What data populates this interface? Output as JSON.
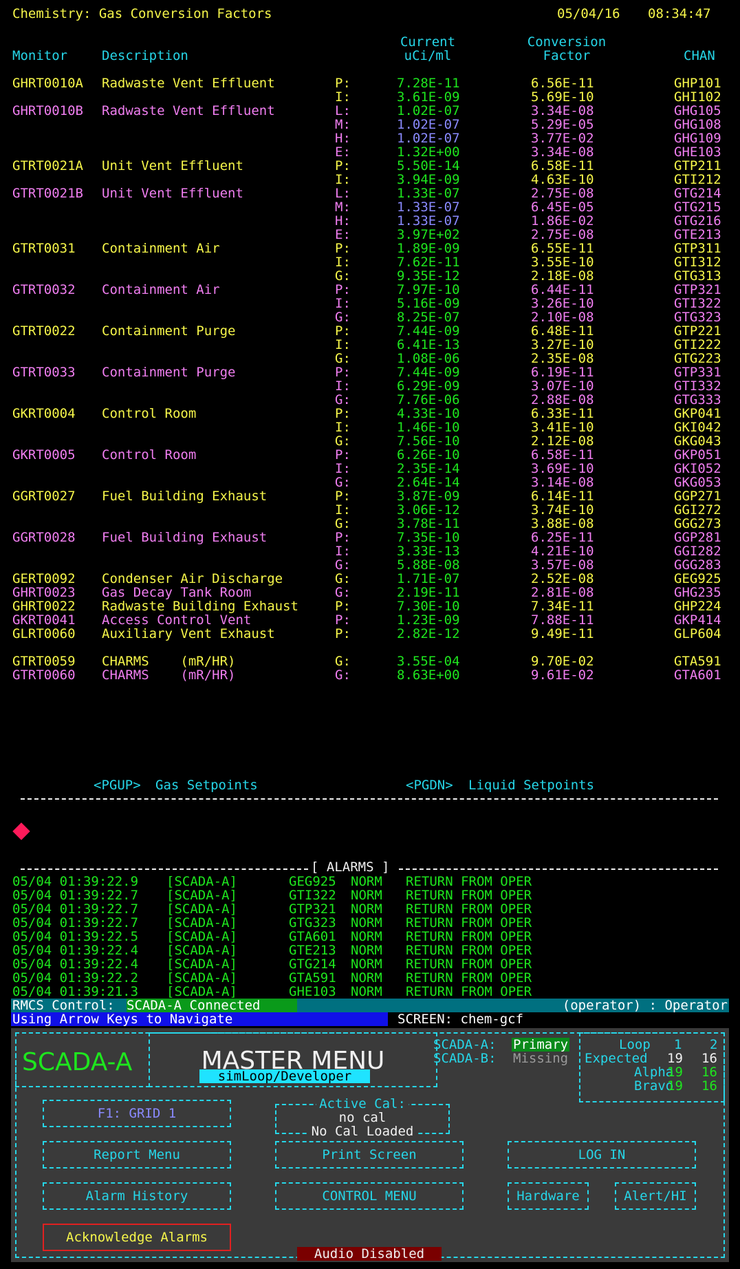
{
  "header": {
    "title": "Chemistry: Gas Conversion Factors",
    "date": "05/04/16",
    "time": "08:34:47"
  },
  "columns": {
    "monitor": "Monitor",
    "description": "Description",
    "current1": "Current",
    "current2": "uCi/ml",
    "conversion1": "Conversion",
    "conversion2": "Factor",
    "chan": "CHAN"
  },
  "rows": [
    {
      "mon": "GHRT0010A",
      "desc": "Radwaste Vent Effluent",
      "type": "P:",
      "cur": "7.28E-11",
      "conv": "6.56E-11",
      "chan": "GHP101",
      "mc": "yellow",
      "curc": "green"
    },
    {
      "mon": "",
      "desc": "",
      "type": "I:",
      "cur": "3.61E-09",
      "conv": "5.69E-10",
      "chan": "GHI102",
      "mc": "yellow",
      "curc": "green"
    },
    {
      "mon": "GHRT0010B",
      "desc": "Radwaste Vent Effluent",
      "type": "L:",
      "cur": "1.02E-07",
      "conv": "3.34E-08",
      "chan": "GHG105",
      "mc": "pink",
      "curc": "green"
    },
    {
      "mon": "",
      "desc": "",
      "type": "M:",
      "cur": "1.02E-07",
      "conv": "5.29E-05",
      "chan": "GHG108",
      "mc": "pink",
      "curc": "blue"
    },
    {
      "mon": "",
      "desc": "",
      "type": "H:",
      "cur": "1.02E-07",
      "conv": "3.77E-02",
      "chan": "GHG109",
      "mc": "pink",
      "curc": "blue"
    },
    {
      "mon": "",
      "desc": "",
      "type": "E:",
      "cur": "1.32E+00",
      "conv": "3.34E-08",
      "chan": "GHE103",
      "mc": "pink",
      "curc": "green"
    },
    {
      "mon": "GTRT0021A",
      "desc": "Unit Vent Effluent",
      "type": "P:",
      "cur": "5.50E-14",
      "conv": "6.58E-11",
      "chan": "GTP211",
      "mc": "yellow",
      "curc": "green"
    },
    {
      "mon": "",
      "desc": "",
      "type": "I:",
      "cur": "3.94E-09",
      "conv": "4.63E-10",
      "chan": "GTI212",
      "mc": "yellow",
      "curc": "green"
    },
    {
      "mon": "GTRT0021B",
      "desc": "Unit Vent Effluent",
      "type": "L:",
      "cur": "1.33E-07",
      "conv": "2.75E-08",
      "chan": "GTG214",
      "mc": "pink",
      "curc": "green"
    },
    {
      "mon": "",
      "desc": "",
      "type": "M:",
      "cur": "1.33E-07",
      "conv": "6.45E-05",
      "chan": "GTG215",
      "mc": "pink",
      "curc": "blue"
    },
    {
      "mon": "",
      "desc": "",
      "type": "H:",
      "cur": "1.33E-07",
      "conv": "1.86E-02",
      "chan": "GTG216",
      "mc": "pink",
      "curc": "blue"
    },
    {
      "mon": "",
      "desc": "",
      "type": "E:",
      "cur": "3.97E+02",
      "conv": "2.75E-08",
      "chan": "GTE213",
      "mc": "pink",
      "curc": "green"
    },
    {
      "mon": "GTRT0031",
      "desc": "Containment Air",
      "type": "P:",
      "cur": "1.89E-09",
      "conv": "6.55E-11",
      "chan": "GTP311",
      "mc": "yellow",
      "curc": "green"
    },
    {
      "mon": "",
      "desc": "",
      "type": "I:",
      "cur": "7.62E-11",
      "conv": "3.55E-10",
      "chan": "GTI312",
      "mc": "yellow",
      "curc": "green"
    },
    {
      "mon": "",
      "desc": "",
      "type": "G:",
      "cur": "9.35E-12",
      "conv": "2.18E-08",
      "chan": "GTG313",
      "mc": "yellow",
      "curc": "green"
    },
    {
      "mon": "GTRT0032",
      "desc": "Containment Air",
      "type": "P:",
      "cur": "7.97E-10",
      "conv": "6.44E-11",
      "chan": "GTP321",
      "mc": "pink",
      "curc": "green"
    },
    {
      "mon": "",
      "desc": "",
      "type": "I:",
      "cur": "5.16E-09",
      "conv": "3.26E-10",
      "chan": "GTI322",
      "mc": "pink",
      "curc": "green"
    },
    {
      "mon": "",
      "desc": "",
      "type": "G:",
      "cur": "8.25E-07",
      "conv": "2.10E-08",
      "chan": "GTG323",
      "mc": "pink",
      "curc": "green"
    },
    {
      "mon": "GTRT0022",
      "desc": "Containment Purge",
      "type": "P:",
      "cur": "7.44E-09",
      "conv": "6.48E-11",
      "chan": "GTP221",
      "mc": "yellow",
      "curc": "green"
    },
    {
      "mon": "",
      "desc": "",
      "type": "I:",
      "cur": "6.41E-13",
      "conv": "3.27E-10",
      "chan": "GTI222",
      "mc": "yellow",
      "curc": "green"
    },
    {
      "mon": "",
      "desc": "",
      "type": "G:",
      "cur": "1.08E-06",
      "conv": "2.35E-08",
      "chan": "GTG223",
      "mc": "yellow",
      "curc": "green"
    },
    {
      "mon": "GTRT0033",
      "desc": "Containment Purge",
      "type": "P:",
      "cur": "7.44E-09",
      "conv": "6.19E-11",
      "chan": "GTP331",
      "mc": "pink",
      "curc": "green"
    },
    {
      "mon": "",
      "desc": "",
      "type": "I:",
      "cur": "6.29E-09",
      "conv": "3.07E-10",
      "chan": "GTI332",
      "mc": "pink",
      "curc": "green"
    },
    {
      "mon": "",
      "desc": "",
      "type": "G:",
      "cur": "7.76E-06",
      "conv": "2.88E-08",
      "chan": "GTG333",
      "mc": "pink",
      "curc": "green"
    },
    {
      "mon": "GKRT0004",
      "desc": "Control Room",
      "type": "P:",
      "cur": "4.33E-10",
      "conv": "6.33E-11",
      "chan": "GKP041",
      "mc": "yellow",
      "curc": "green"
    },
    {
      "mon": "",
      "desc": "",
      "type": "I:",
      "cur": "1.46E-10",
      "conv": "3.41E-10",
      "chan": "GKI042",
      "mc": "yellow",
      "curc": "green"
    },
    {
      "mon": "",
      "desc": "",
      "type": "G:",
      "cur": "7.56E-10",
      "conv": "2.12E-08",
      "chan": "GKG043",
      "mc": "yellow",
      "curc": "green"
    },
    {
      "mon": "GKRT0005",
      "desc": "Control Room",
      "type": "P:",
      "cur": "6.26E-10",
      "conv": "6.58E-11",
      "chan": "GKP051",
      "mc": "pink",
      "curc": "green"
    },
    {
      "mon": "",
      "desc": "",
      "type": "I:",
      "cur": "2.35E-14",
      "conv": "3.69E-10",
      "chan": "GKI052",
      "mc": "pink",
      "curc": "green"
    },
    {
      "mon": "",
      "desc": "",
      "type": "G:",
      "cur": "2.64E-14",
      "conv": "3.14E-08",
      "chan": "GKG053",
      "mc": "pink",
      "curc": "green"
    },
    {
      "mon": "GGRT0027",
      "desc": "Fuel Building Exhaust",
      "type": "P:",
      "cur": "3.87E-09",
      "conv": "6.14E-11",
      "chan": "GGP271",
      "mc": "yellow",
      "curc": "green"
    },
    {
      "mon": "",
      "desc": "",
      "type": "I:",
      "cur": "3.06E-12",
      "conv": "3.74E-10",
      "chan": "GGI272",
      "mc": "yellow",
      "curc": "green"
    },
    {
      "mon": "",
      "desc": "",
      "type": "G:",
      "cur": "3.78E-11",
      "conv": "3.88E-08",
      "chan": "GGG273",
      "mc": "yellow",
      "curc": "green"
    },
    {
      "mon": "GGRT0028",
      "desc": "Fuel Building Exhaust",
      "type": "P:",
      "cur": "7.35E-10",
      "conv": "6.25E-11",
      "chan": "GGP281",
      "mc": "pink",
      "curc": "green"
    },
    {
      "mon": "",
      "desc": "",
      "type": "I:",
      "cur": "3.33E-13",
      "conv": "4.21E-10",
      "chan": "GGI282",
      "mc": "pink",
      "curc": "green"
    },
    {
      "mon": "",
      "desc": "",
      "type": "G:",
      "cur": "5.88E-08",
      "conv": "3.57E-08",
      "chan": "GGG283",
      "mc": "pink",
      "curc": "green"
    },
    {
      "mon": "GERT0092",
      "desc": "Condenser Air Discharge",
      "type": "G:",
      "cur": "1.71E-07",
      "conv": "2.52E-08",
      "chan": "GEG925",
      "mc": "yellow",
      "curc": "green"
    },
    {
      "mon": "GHRT0023",
      "desc": "Gas Decay Tank Room",
      "type": "G:",
      "cur": "2.19E-11",
      "conv": "2.81E-08",
      "chan": "GHG235",
      "mc": "pink",
      "curc": "green"
    },
    {
      "mon": "GHRT0022",
      "desc": "Radwaste Building Exhaust",
      "type": "P:",
      "cur": "7.30E-10",
      "conv": "7.34E-11",
      "chan": "GHP224",
      "mc": "yellow",
      "curc": "green"
    },
    {
      "mon": "GKRT0041",
      "desc": "Access Control Vent",
      "type": "P:",
      "cur": "1.23E-09",
      "conv": "7.88E-11",
      "chan": "GKP414",
      "mc": "pink",
      "curc": "green"
    },
    {
      "mon": "GLRT0060",
      "desc": "Auxiliary Vent Exhaust",
      "type": "P:",
      "cur": "2.82E-12",
      "conv": "9.49E-11",
      "chan": "GLP604",
      "mc": "yellow",
      "curc": "green"
    },
    {
      "mon": "",
      "desc": "",
      "type": "",
      "cur": "",
      "conv": "",
      "chan": "",
      "mc": "yellow",
      "curc": "green"
    },
    {
      "mon": "GTRT0059",
      "desc": "CHARMS    (mR/HR)",
      "type": "G:",
      "cur": "3.55E-04",
      "conv": "9.70E-02",
      "chan": "GTA591",
      "mc": "yellow",
      "curc": "green"
    },
    {
      "mon": "GTRT0060",
      "desc": "CHARMS    (mR/HR)",
      "type": "G:",
      "cur": "8.63E+00",
      "conv": "9.61E-02",
      "chan": "GTA601",
      "mc": "pink",
      "curc": "green"
    }
  ],
  "nav": {
    "pgup_key": "<PGUP>",
    "pgup_label": "Gas Setpoints",
    "pgdn_key": "<PGDN>",
    "pgdn_label": "Liquid Setpoints"
  },
  "alarms_title": "[ ALARMS ]",
  "alarms": [
    {
      "ts": "05/04 01:39:22.9",
      "src": "[SCADA-A]",
      "chan": "GEG925",
      "state": "NORM",
      "msg": "RETURN FROM OPER"
    },
    {
      "ts": "05/04 01:39:22.7",
      "src": "[SCADA-A]",
      "chan": "GTI322",
      "state": "NORM",
      "msg": "RETURN FROM OPER"
    },
    {
      "ts": "05/04 01:39:22.7",
      "src": "[SCADA-A]",
      "chan": "GTP321",
      "state": "NORM",
      "msg": "RETURN FROM OPER"
    },
    {
      "ts": "05/04 01:39:22.7",
      "src": "[SCADA-A]",
      "chan": "GTG323",
      "state": "NORM",
      "msg": "RETURN FROM OPER"
    },
    {
      "ts": "05/04 01:39:22.5",
      "src": "[SCADA-A]",
      "chan": "GTA601",
      "state": "NORM",
      "msg": "RETURN FROM OPER"
    },
    {
      "ts": "05/04 01:39:22.4",
      "src": "[SCADA-A]",
      "chan": "GTE213",
      "state": "NORM",
      "msg": "RETURN FROM OPER"
    },
    {
      "ts": "05/04 01:39:22.4",
      "src": "[SCADA-A]",
      "chan": "GTG214",
      "state": "NORM",
      "msg": "RETURN FROM OPER"
    },
    {
      "ts": "05/04 01:39:22.2",
      "src": "[SCADA-A]",
      "chan": "GTA591",
      "state": "NORM",
      "msg": "RETURN FROM OPER"
    },
    {
      "ts": "05/04 01:39:21.3",
      "src": "[SCADA-A]",
      "chan": "GHE103",
      "state": "NORM",
      "msg": "RETURN FROM OPER"
    }
  ],
  "status": {
    "rmcs_label": "RMCS Control:",
    "rmcs_value": "SCADA-A Connected",
    "user": "(operator) : Operator",
    "hint": "Using Arrow Keys to Navigate",
    "screen": "SCREEN: chem-gcf"
  },
  "menu": {
    "scada": "SCADA-A",
    "title": "MASTER MENU",
    "subtitle": "simLoop/Developer",
    "scada_a_label": "SCADA-A:",
    "scada_a_value": "Primary",
    "scada_b_label": "SCADA-B:",
    "scada_b_value": "Missing",
    "loop_label": "Loop",
    "loop1": "1",
    "loop2": "2",
    "expected_label": "Expected",
    "expected1": "19",
    "expected2": "16",
    "alpha_label": "Alpha",
    "alpha1": "19",
    "alpha2": "16",
    "bravo_label": "Bravo",
    "bravo1": "19",
    "bravo2": "16",
    "f1": "F1:   GRID 1",
    "activecal_title": "Active Cal:",
    "activecal_value": "no cal",
    "activecal_loaded": "No Cal Loaded",
    "report": "Report  Menu",
    "print": "Print Screen",
    "login": "LOG IN",
    "alarm_history": "Alarm  History",
    "control": "CONTROL MENU",
    "hardware": "Hardware",
    "alert": "Alert/HI",
    "ack": "Acknowledge Alarms",
    "audio": "Audio Disabled"
  },
  "colors": {
    "yellow": "#f6f64a",
    "pink": "#f07ef0",
    "cyan": "#26d6e8",
    "green": "#1ee61e",
    "blue": "#8a8aff",
    "panel": "#3a3a3a",
    "red": "#8b0000"
  }
}
